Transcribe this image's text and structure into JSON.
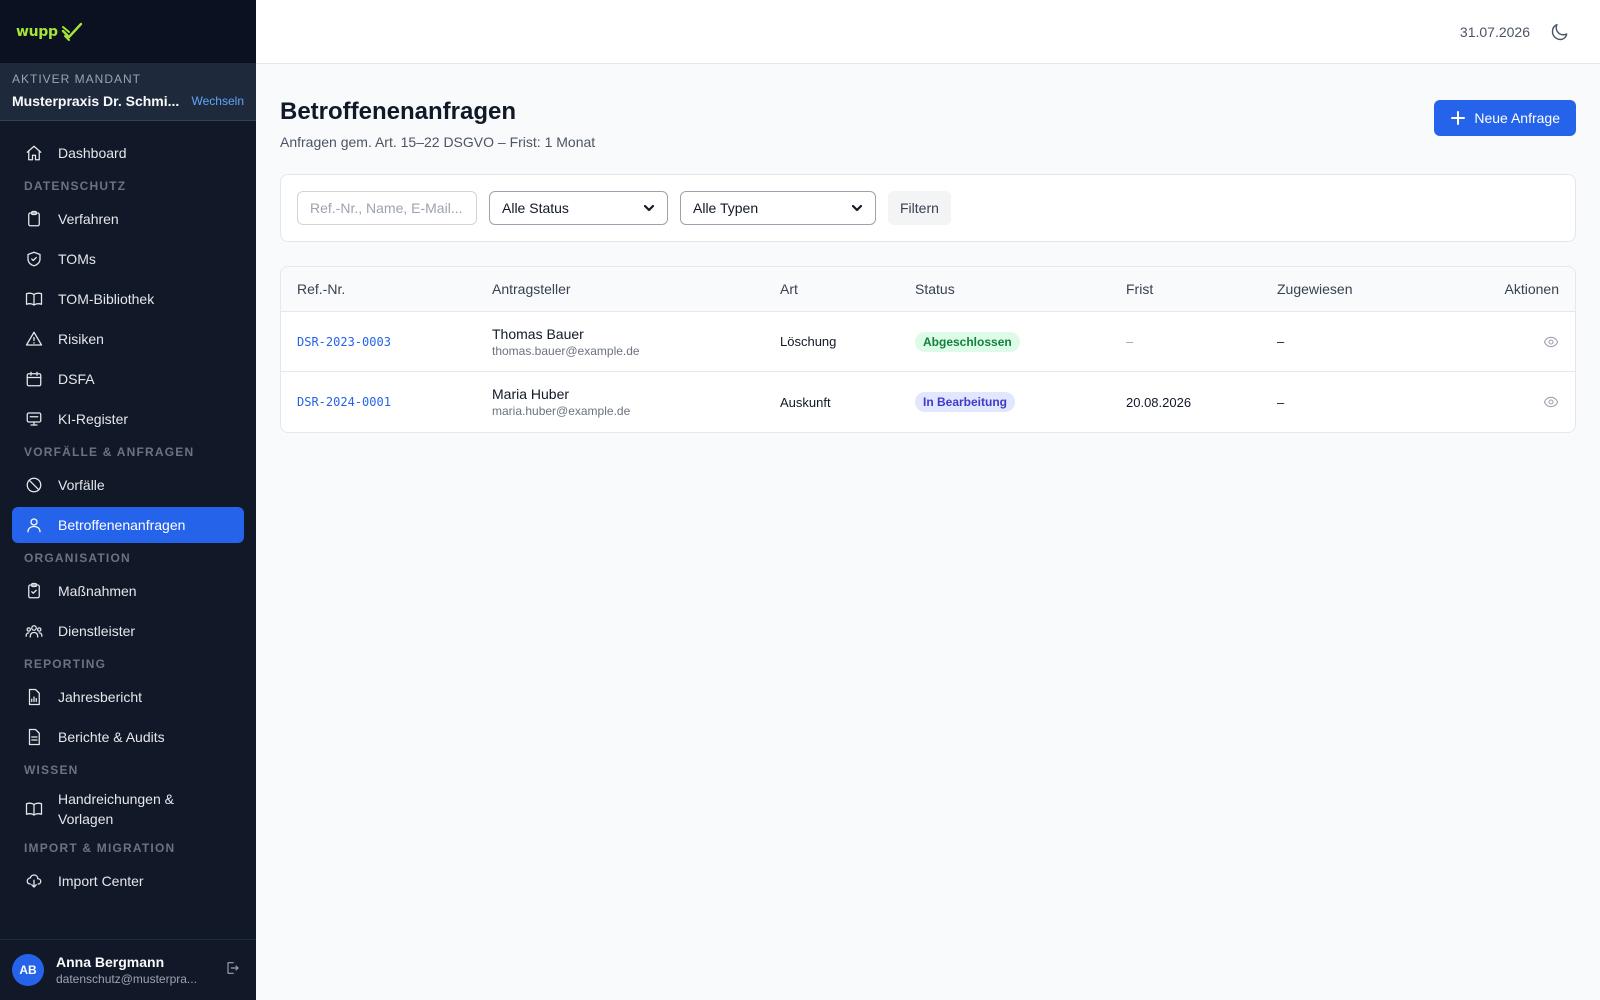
{
  "brand": {
    "logo_text": "wupp"
  },
  "mandant": {
    "label": "Aktiver Mandant",
    "name": "Musterpraxis Dr. Schmi...",
    "switch_label": "Wechseln"
  },
  "sidebar": {
    "dashboard": "Dashboard",
    "sections": {
      "datenschutz": "Datenschutz",
      "vorfaelle": "Vorfälle & Anfragen",
      "organisation": "Organisation",
      "reporting": "Reporting",
      "wissen": "Wissen",
      "import": "Import & Migration"
    },
    "items": {
      "verfahren": "Verfahren",
      "toms": "TOMs",
      "tom_bibliothek": "TOM-Bibliothek",
      "risiken": "Risiken",
      "dsfa": "DSFA",
      "ki_register": "KI-Register",
      "vorfaelle": "Vorfälle",
      "betroffenenanfragen": "Betroffenenanfragen",
      "massnahmen": "Maßnahmen",
      "dienstleister": "Dienstleister",
      "jahresbericht": "Jahresbericht",
      "berichte_audits": "Berichte & Audits",
      "handreichungen": "Handreichungen & Vorlagen",
      "import_center": "Import Center"
    }
  },
  "user": {
    "initials": "AB",
    "name": "Anna Bergmann",
    "email": "datenschutz@musterpra..."
  },
  "header": {
    "date": "31.07.2026"
  },
  "page": {
    "title": "Betroffenenanfragen",
    "subtitle": "Anfragen gem. Art. 15–22 DSGVO – Frist: 1 Monat",
    "new_button": "Neue Anfrage"
  },
  "filters": {
    "search_placeholder": "Ref.-Nr., Name, E-Mail...",
    "status_selected": "Alle Status",
    "type_selected": "Alle Typen",
    "filter_button": "Filtern"
  },
  "table": {
    "headers": {
      "ref": "Ref.-Nr.",
      "applicant": "Antragsteller",
      "type": "Art",
      "status": "Status",
      "deadline": "Frist",
      "assigned": "Zugewiesen",
      "actions": "Aktionen"
    },
    "rows": [
      {
        "ref": "DSR-2023-0003",
        "name": "Thomas Bauer",
        "email": "thomas.bauer@example.de",
        "type": "Löschung",
        "status": "Abgeschlossen",
        "deadline": "–",
        "assigned": "–"
      },
      {
        "ref": "DSR-2024-0001",
        "name": "Maria Huber",
        "email": "maria.huber@example.de",
        "type": "Auskunft",
        "status": "In Bearbeitung",
        "deadline": "20.08.2026",
        "assigned": "–"
      }
    ]
  },
  "colors": {
    "accent": "#2563eb",
    "sidebar_bg": "#111827",
    "badge_done": "#15803d",
    "badge_work": "#4338ca"
  }
}
